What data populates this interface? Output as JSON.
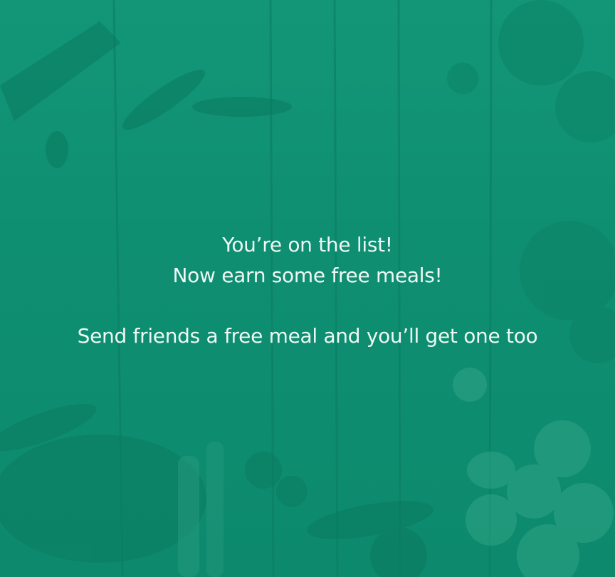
{
  "message": {
    "line1": "You’re on the list!",
    "line2": "Now earn some free meals!",
    "line3": "Send friends a free meal and you’ll get one too"
  },
  "colors": {
    "background": "#119473",
    "text": "#eef8f4"
  },
  "background_image": "wooden-table-with-vegetables"
}
